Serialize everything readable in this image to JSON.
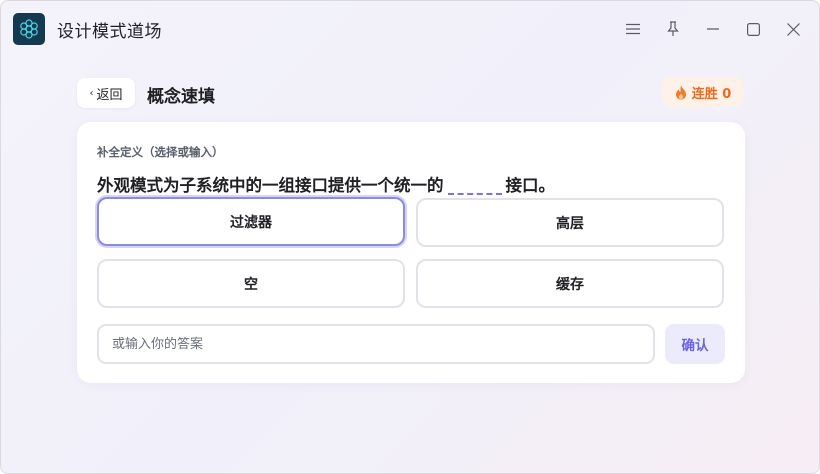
{
  "window": {
    "app_title": "设计模式道场",
    "app_icon": "flower-network-icon",
    "controls": {
      "menu_icon": "menu-icon",
      "pin_icon": "pin-icon",
      "minimize_icon": "minimize-icon",
      "maximize_icon": "maximize-icon",
      "close_icon": "close-icon"
    }
  },
  "header": {
    "back_label": "返回",
    "title": "概念速填",
    "streak_label": "连胜 0",
    "streak_icon": "flame-icon"
  },
  "quiz": {
    "hint": "补全定义（选择或输入）",
    "question_before": "外观模式为子系统中的一组接口提供一个统一的",
    "question_after": "接口。",
    "options": [
      {
        "label": "过滤器",
        "selected": true
      },
      {
        "label": "高层",
        "selected": false
      },
      {
        "label": "空",
        "selected": false
      },
      {
        "label": "缓存",
        "selected": false
      }
    ],
    "input": {
      "value": "",
      "placeholder": "或输入你的答案"
    },
    "confirm_label": "确认"
  },
  "colors": {
    "accent": "#6b63e6",
    "selected_border": "#8c8ae6",
    "streak": "#ea6a1b",
    "app_icon_bg": "#143a4f"
  }
}
